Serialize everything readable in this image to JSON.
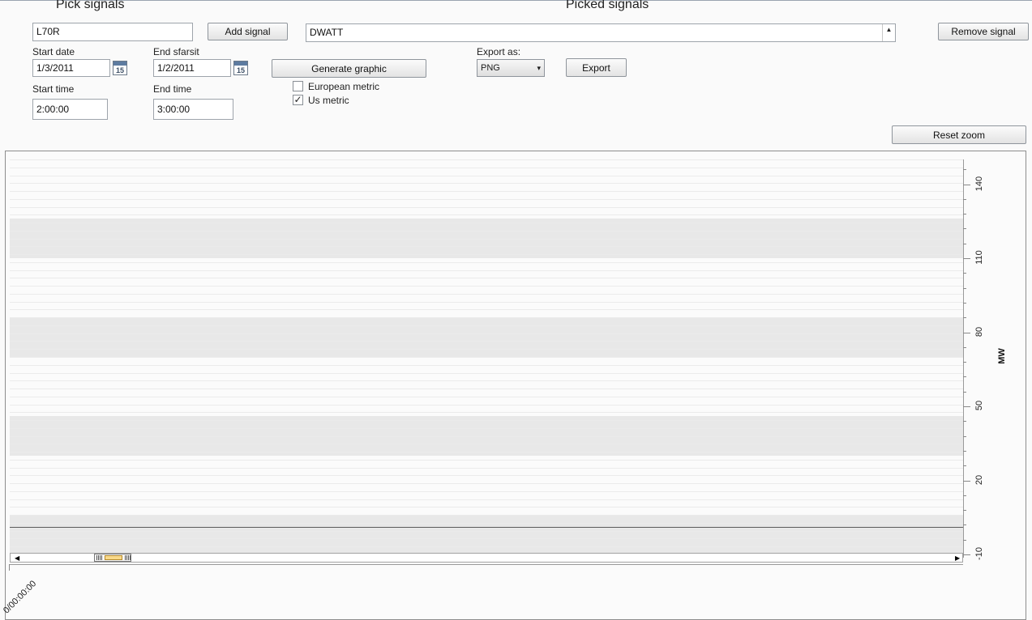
{
  "headings": {
    "pick_signals": "Pick signals",
    "picked_signals": "Picked signals"
  },
  "pick": {
    "signal_value": "L70R",
    "add_button": "Add signal"
  },
  "picked": {
    "signal_value": "DWATT",
    "remove_button": "Remove signal"
  },
  "dates": {
    "start_date_label": "Start date",
    "start_date_value": "1/3/2011",
    "end_date_label": "End sfarsit",
    "end_date_value": "1/2/2011",
    "calendar_glyph": "15"
  },
  "times": {
    "start_time_label": "Start time",
    "start_time_value": "2:00:00",
    "end_time_label": "End time",
    "end_time_value": "3:00:00"
  },
  "generate_button": "Generate graphic",
  "metric": {
    "european_label": "European metric",
    "european_checked": false,
    "us_label": "Us metric",
    "us_checked": true,
    "check_glyph": "✓"
  },
  "export": {
    "label": "Export as:",
    "format_value": "PNG",
    "dropdown_arrow": "▾",
    "button": "Export"
  },
  "reset_zoom_button": "Reset zoom",
  "chart_data": {
    "type": "line",
    "y_label": "MW",
    "y_ticks": [
      "-10",
      "20",
      "50",
      "80",
      "110",
      "140"
    ],
    "x_ticks": [
      "0/00:00:00"
    ],
    "ylim": [
      -10,
      150
    ],
    "series": [],
    "grid": true
  },
  "scrollbar": {
    "left_arrow": "◀",
    "right_arrow": "▶"
  }
}
